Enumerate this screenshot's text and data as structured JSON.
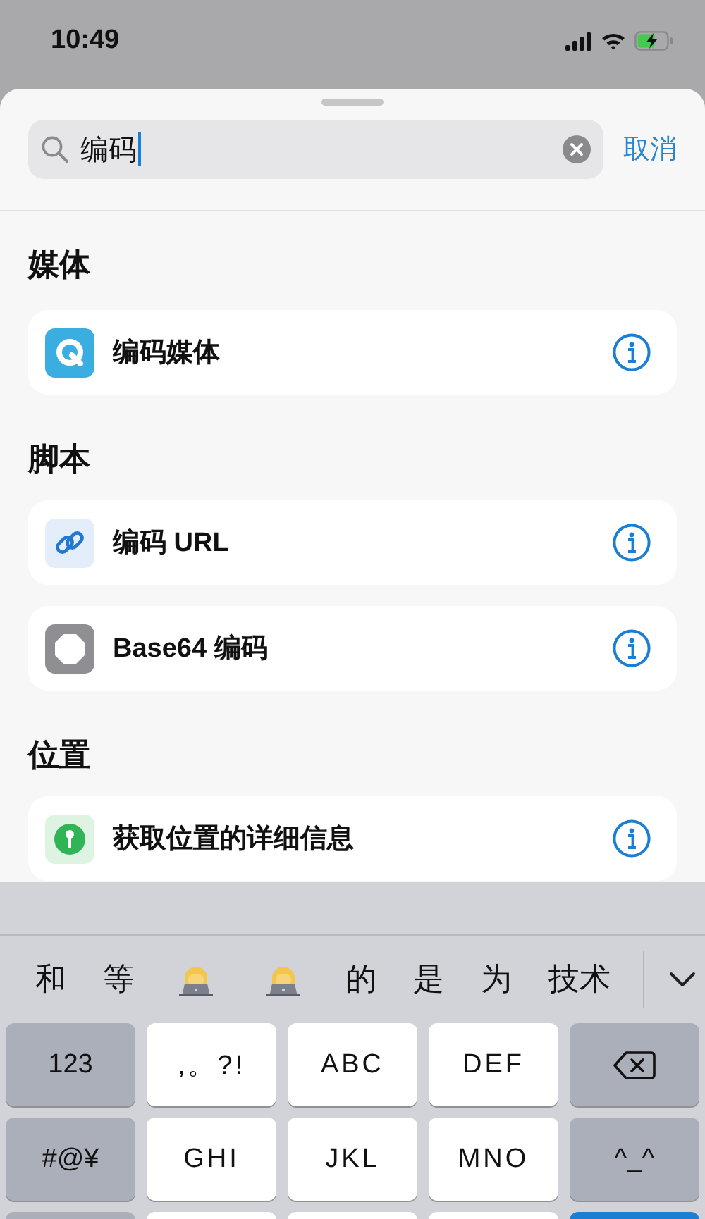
{
  "status_bar": {
    "time": "10:49"
  },
  "search": {
    "value": "编码",
    "cancel": "取消"
  },
  "sections": [
    {
      "title": "媒体",
      "items": [
        {
          "kind": "media",
          "label": "编码媒体"
        }
      ]
    },
    {
      "title": "脚本",
      "items": [
        {
          "kind": "link",
          "label": "编码 URL"
        },
        {
          "kind": "script",
          "label": "Base64 编码"
        }
      ]
    },
    {
      "title": "位置",
      "items": [
        {
          "kind": "location",
          "label": "获取位置的详细信息"
        }
      ]
    }
  ],
  "keyboard": {
    "candidates": [
      {
        "kind": "text",
        "label": "和"
      },
      {
        "kind": "text",
        "label": "等"
      },
      {
        "kind": "emoji"
      },
      {
        "kind": "emoji"
      },
      {
        "kind": "text",
        "label": "的"
      },
      {
        "kind": "text",
        "label": "是"
      },
      {
        "kind": "text",
        "label": "为"
      },
      {
        "kind": "text",
        "label": "技术"
      }
    ],
    "rows": [
      [
        {
          "kind": "function",
          "label": "123"
        },
        {
          "kind": "letter",
          "label": ",。?!"
        },
        {
          "kind": "letter",
          "label": "ABC"
        },
        {
          "kind": "letter",
          "label": "DEF"
        },
        {
          "kind": "delete"
        }
      ],
      [
        {
          "kind": "function",
          "label": "#@¥"
        },
        {
          "kind": "letter",
          "label": "GHI"
        },
        {
          "kind": "letter",
          "label": "JKL"
        },
        {
          "kind": "letter",
          "label": "MNO"
        },
        {
          "kind": "function",
          "label": "^_^"
        }
      ],
      [
        {
          "kind": "function"
        },
        {
          "kind": "letter"
        },
        {
          "kind": "letter"
        },
        {
          "kind": "letter"
        },
        {
          "kind": "action"
        }
      ]
    ]
  }
}
